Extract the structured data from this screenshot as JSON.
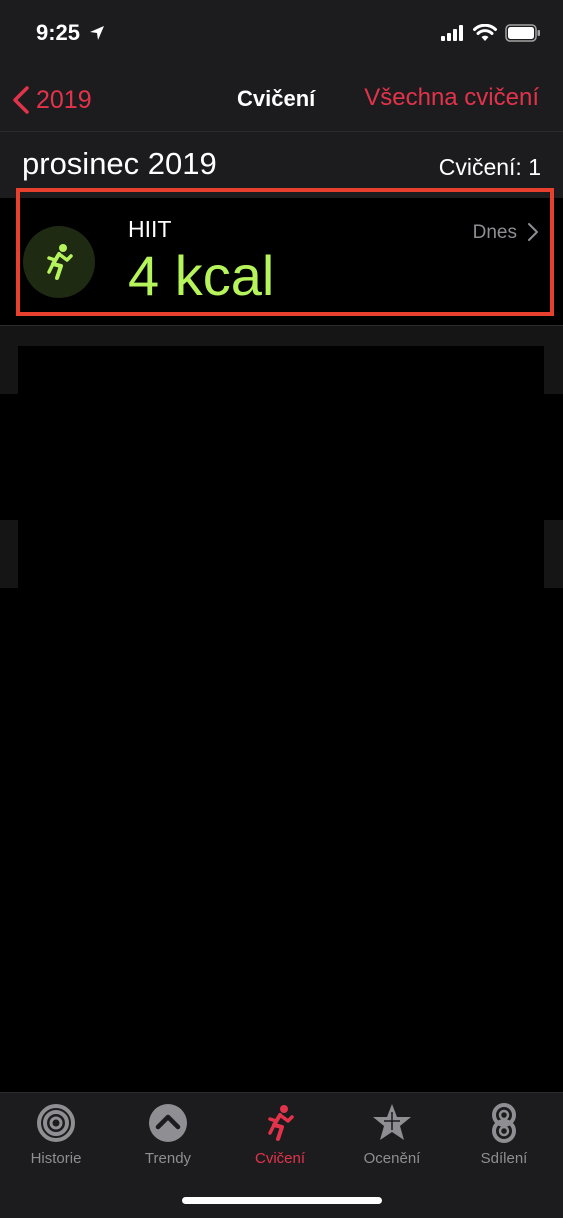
{
  "status": {
    "time": "9:25"
  },
  "nav": {
    "back_label": "2019",
    "title": "Cvičení",
    "right_label": "Všechna cvičení"
  },
  "section": {
    "month": "prosinec 2019",
    "count_label": "Cvičení: 1"
  },
  "workouts": [
    {
      "name": "HIIT",
      "kcal": "4 kcal",
      "date": "Dnes",
      "icon": "running-figure-icon"
    }
  ],
  "colors": {
    "accent_red": "#e3334b",
    "kcal_green": "#b6f45c",
    "highlight_border": "#e8402e"
  },
  "tabs": [
    {
      "label": "Historie",
      "icon": "rings-icon",
      "active": false
    },
    {
      "label": "Trendy",
      "icon": "trend-arrow-icon",
      "active": false
    },
    {
      "label": "Cvičení",
      "icon": "running-figure-icon",
      "active": true
    },
    {
      "label": "Ocenění",
      "icon": "star-award-icon",
      "active": false
    },
    {
      "label": "Sdílení",
      "icon": "sharing-rings-icon",
      "active": false
    }
  ]
}
